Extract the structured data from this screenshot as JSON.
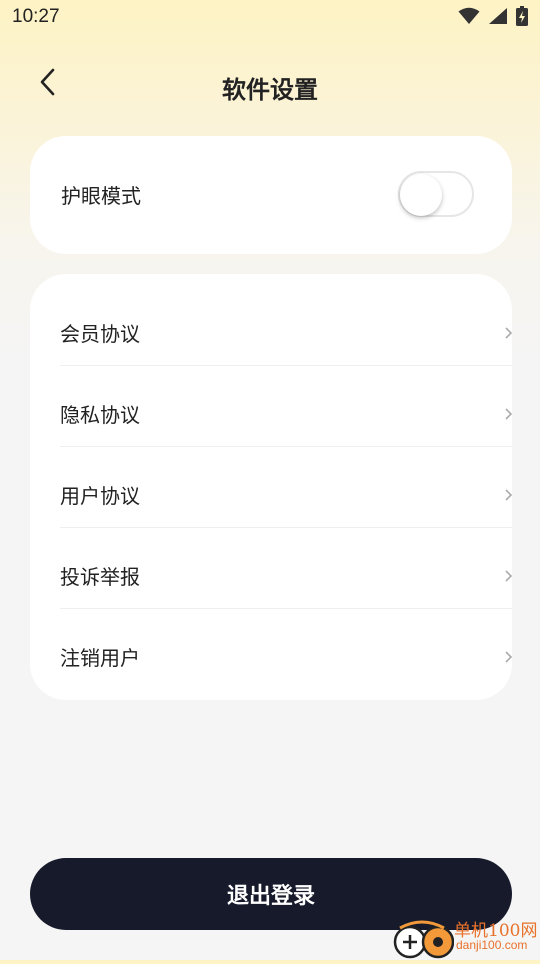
{
  "status_bar": {
    "time": "10:27",
    "icons": [
      "wifi-icon",
      "cell-signal-icon",
      "battery-charging-icon"
    ]
  },
  "header": {
    "back_icon": "chevron-left-icon",
    "title": "软件设置"
  },
  "eye_mode": {
    "label": "护眼模式",
    "enabled": false
  },
  "menu": {
    "items": [
      {
        "label": "会员协议",
        "icon": "chevron-right-icon"
      },
      {
        "label": "隐私协议",
        "icon": "chevron-right-icon"
      },
      {
        "label": "用户协议",
        "icon": "chevron-right-icon"
      },
      {
        "label": "投诉举报",
        "icon": "chevron-right-icon"
      },
      {
        "label": "注销用户",
        "icon": "chevron-right-icon"
      }
    ]
  },
  "logout": {
    "label": "退出登录"
  },
  "watermark": {
    "name": "单机100网",
    "url": "danji100.com"
  },
  "colors": {
    "header_gradient_top": "#fdf3c4",
    "background": "#f5f5f5",
    "button_dark": "#161a2b",
    "watermark_orange": "#e8712b"
  }
}
